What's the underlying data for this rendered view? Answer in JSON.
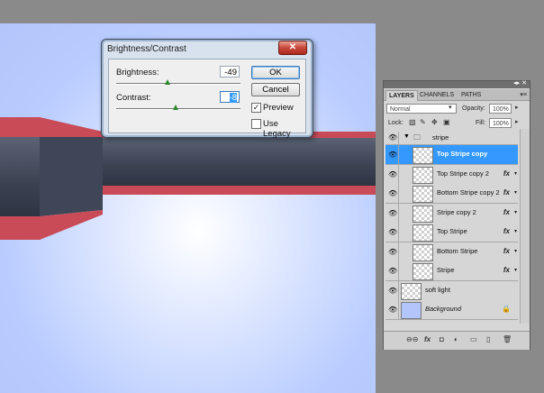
{
  "dialog": {
    "title": "Brightness/Contrast",
    "close": "✕",
    "brightness_label": "Brightness:",
    "brightness_value": "-49",
    "brightness_position": 0.41,
    "contrast_label": "Contrast:",
    "contrast_value": "-8",
    "contrast_position": 0.48,
    "ok": "OK",
    "cancel": "Cancel",
    "preview_label": "Preview",
    "preview_checked": true,
    "legacy_label": "Use Legacy",
    "legacy_checked": false
  },
  "panel": {
    "tabs": [
      "LAYERS",
      "CHANNELS",
      "PATHS"
    ],
    "blend_mode": "Normal",
    "opacity_label": "Opacity:",
    "opacity_value": "100%",
    "lock_label": "Lock:",
    "fill_label": "Fill:",
    "fill_value": "100%",
    "group_name": "stripe",
    "layers": [
      {
        "name": "Top Stripe copy",
        "selected": true,
        "fx": false
      },
      {
        "name": "Top Stripe copy 2",
        "selected": false,
        "fx": true
      },
      {
        "name": "Bottom Stripe copy 2",
        "selected": false,
        "fx": true
      },
      {
        "name": "Stripe copy 2",
        "selected": false,
        "fx": true
      },
      {
        "name": "Top Stripe",
        "selected": false,
        "fx": true
      },
      {
        "name": "Bottom Stripe",
        "selected": false,
        "fx": true
      },
      {
        "name": "Stripe",
        "selected": false,
        "fx": true
      },
      {
        "name": "soft light",
        "selected": false,
        "fx": false
      },
      {
        "name": "Background",
        "selected": false,
        "fx": false,
        "locked": true
      }
    ]
  },
  "colors": {
    "canvas_bg": "#b2c6fb",
    "stripe_red": "#c84b57",
    "stripe_dark": "#3a4252",
    "selection_blue": "#3399ff"
  }
}
